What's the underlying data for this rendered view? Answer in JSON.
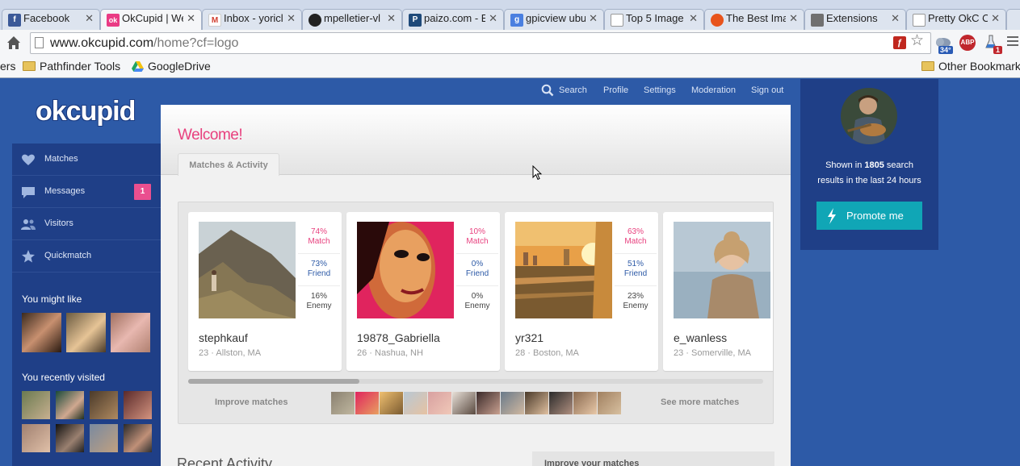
{
  "browser": {
    "tabs": [
      {
        "label": "Facebook",
        "icon": "facebook-icon",
        "color": "#3b5998",
        "glyph": "f",
        "active": false
      },
      {
        "label": "OkCupid | We",
        "icon": "okcupid-icon",
        "color": "#ea3b84",
        "glyph": "ok",
        "active": true
      },
      {
        "label": "Inbox - yoricl",
        "icon": "gmail-icon",
        "color": "#d23f31",
        "glyph": "M",
        "active": false
      },
      {
        "label": "mpelletier-vl",
        "icon": "github-icon",
        "color": "#222222",
        "glyph": "",
        "active": false
      },
      {
        "label": "paizo.com - E",
        "icon": "paizo-icon",
        "color": "#1f4a7a",
        "glyph": "P",
        "active": false
      },
      {
        "label": "gpicview ubu",
        "icon": "google-icon",
        "color": "#4a7fe0",
        "glyph": "g",
        "active": false
      },
      {
        "label": "Top 5 Image",
        "icon": "page-icon",
        "color": "#ffffff",
        "glyph": "",
        "active": false
      },
      {
        "label": "The Best Ima",
        "icon": "site-icon",
        "color": "#e8541c",
        "glyph": "",
        "active": false
      },
      {
        "label": "Extensions",
        "icon": "puzzle-icon",
        "color": "#707070",
        "glyph": "",
        "active": false
      },
      {
        "label": "Pretty OkC O",
        "icon": "page-icon",
        "color": "#ffffff",
        "glyph": "",
        "active": false
      }
    ],
    "url_domain": "www.okcupid.com",
    "url_path": "/home?cf=logo",
    "weather_badge": "34°",
    "abp_label": "ABP",
    "flask_badge": "1",
    "bookmarks": [
      {
        "label": "ers",
        "type": "text"
      },
      {
        "label": "Pathfinder Tools",
        "type": "folder"
      },
      {
        "label": "GoogleDrive",
        "type": "drive"
      },
      {
        "label": "Other Bookmarks",
        "type": "folder"
      }
    ]
  },
  "site": {
    "logo": "okcupid",
    "nav": [
      "Search",
      "Profile",
      "Settings",
      "Moderation",
      "Sign out"
    ]
  },
  "sidebar": {
    "items": [
      {
        "label": "Matches",
        "icon": "heart-icon"
      },
      {
        "label": "Messages",
        "icon": "chat-bubble-icon",
        "badge": "1"
      },
      {
        "label": "Visitors",
        "icon": "people-icon"
      },
      {
        "label": "Quickmatch",
        "icon": "star-icon"
      }
    ],
    "might_like_title": "You might like",
    "recently_visited_title": "You recently visited"
  },
  "main": {
    "welcome": "Welcome!",
    "tab": "Matches & Activity",
    "matches": [
      {
        "name": "stephkauf",
        "age": "23",
        "location": "Allston, MA",
        "match": "74%",
        "friend": "73%",
        "enemy": "16%"
      },
      {
        "name": "19878_Gabriella",
        "age": "26",
        "location": "Nashua, NH",
        "match": "10%",
        "friend": "0%",
        "enemy": "0%"
      },
      {
        "name": "yr321",
        "age": "28",
        "location": "Boston, MA",
        "match": "63%",
        "friend": "51%",
        "enemy": "23%"
      },
      {
        "name": "e_wanless",
        "age": "23",
        "location": "Somerville, MA",
        "match": "",
        "friend": "",
        "enemy": ""
      }
    ],
    "stat_labels": {
      "match": "Match",
      "friend": "Friend",
      "enemy": "Enemy"
    },
    "improve_matches": "Improve matches",
    "see_more": "See more matches",
    "recent_activity": "Recent Activity",
    "improve_box_title": "Improve your matches"
  },
  "promo": {
    "shown_prefix": "Shown in ",
    "shown_count": "1805",
    "shown_suffix": " search",
    "shown_line2": "results in the last 24 hours",
    "button": "Promote me"
  }
}
